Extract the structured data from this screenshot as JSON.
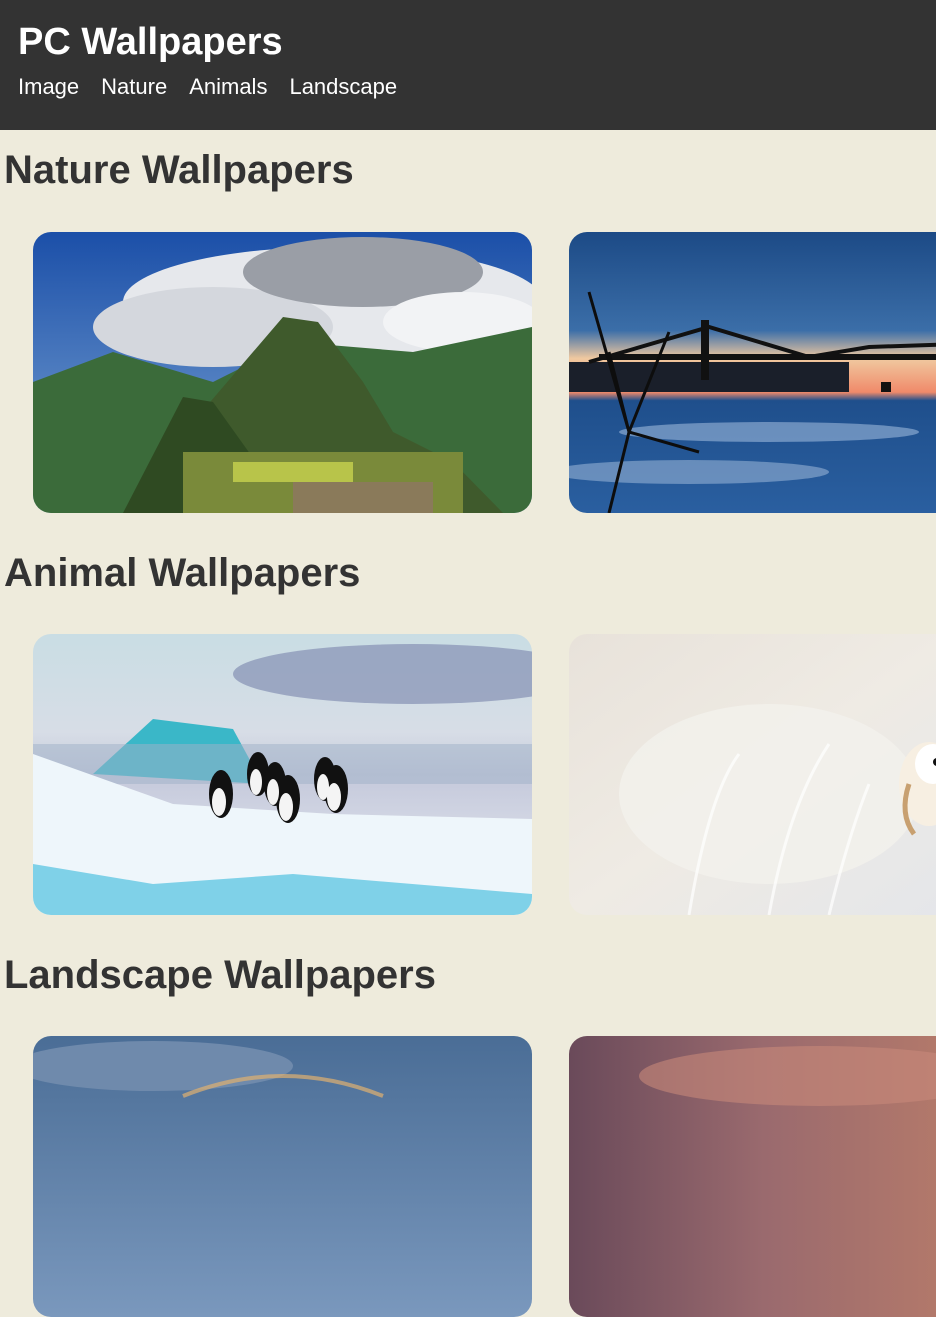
{
  "header": {
    "title": "PC Wallpapers",
    "nav": [
      "Image",
      "Nature",
      "Animals",
      "Landscape"
    ]
  },
  "sections": [
    {
      "title": "Nature Wallpapers",
      "images": [
        "mountain-ruins-photo",
        "bridge-sunset-photo"
      ]
    },
    {
      "title": "Animal Wallpapers",
      "images": [
        "penguins-on-ice-photo",
        "snowy-owl-photo"
      ]
    },
    {
      "title": "Landscape Wallpapers",
      "images": [
        "rainbow-sky-photo",
        "dusk-sky-photo"
      ]
    }
  ],
  "colors": {
    "header_bg": "#333333",
    "page_bg": "#eeebdc",
    "heading_text": "#333333",
    "header_text": "#ffffff"
  }
}
